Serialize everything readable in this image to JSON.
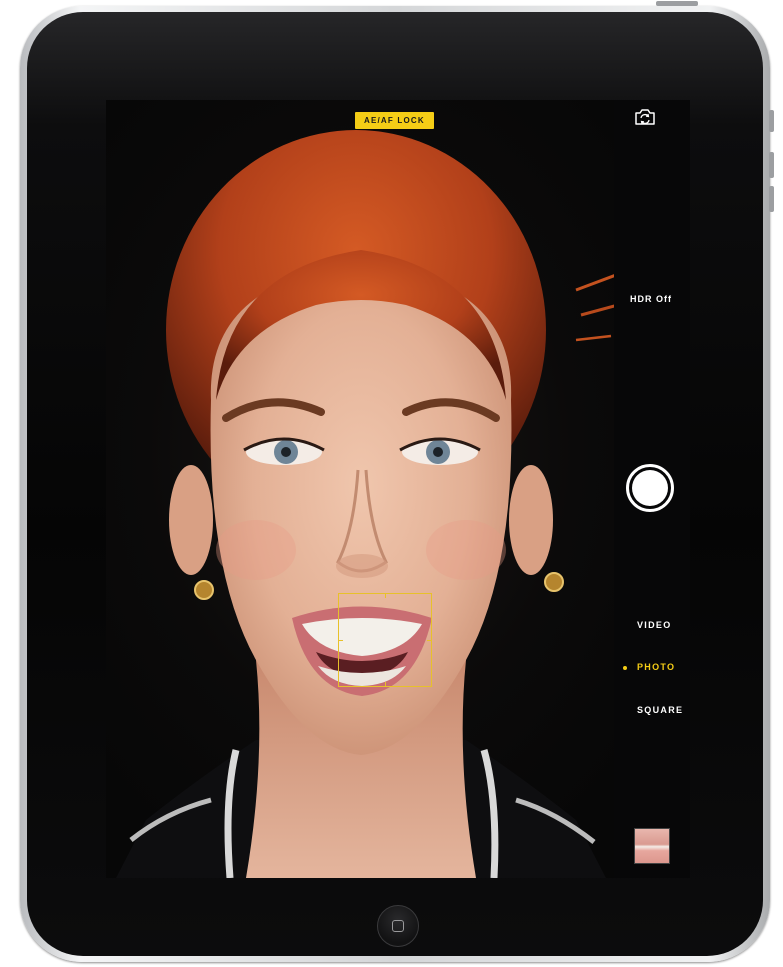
{
  "camera": {
    "lock_badge": "AE/AF LOCK",
    "hdr_label": "HDR Off",
    "modes": [
      "VIDEO",
      "PHOTO",
      "SQUARE"
    ],
    "active_mode": "PHOTO"
  },
  "icons": {
    "flip_camera": "camera-flip-icon",
    "shutter": "shutter-icon",
    "home": "home-button-icon"
  },
  "colors": {
    "accent_yellow": "#f5cd16",
    "hair": "#b8441c",
    "skin": "#e2b39a",
    "background": "#0a0a0b"
  }
}
